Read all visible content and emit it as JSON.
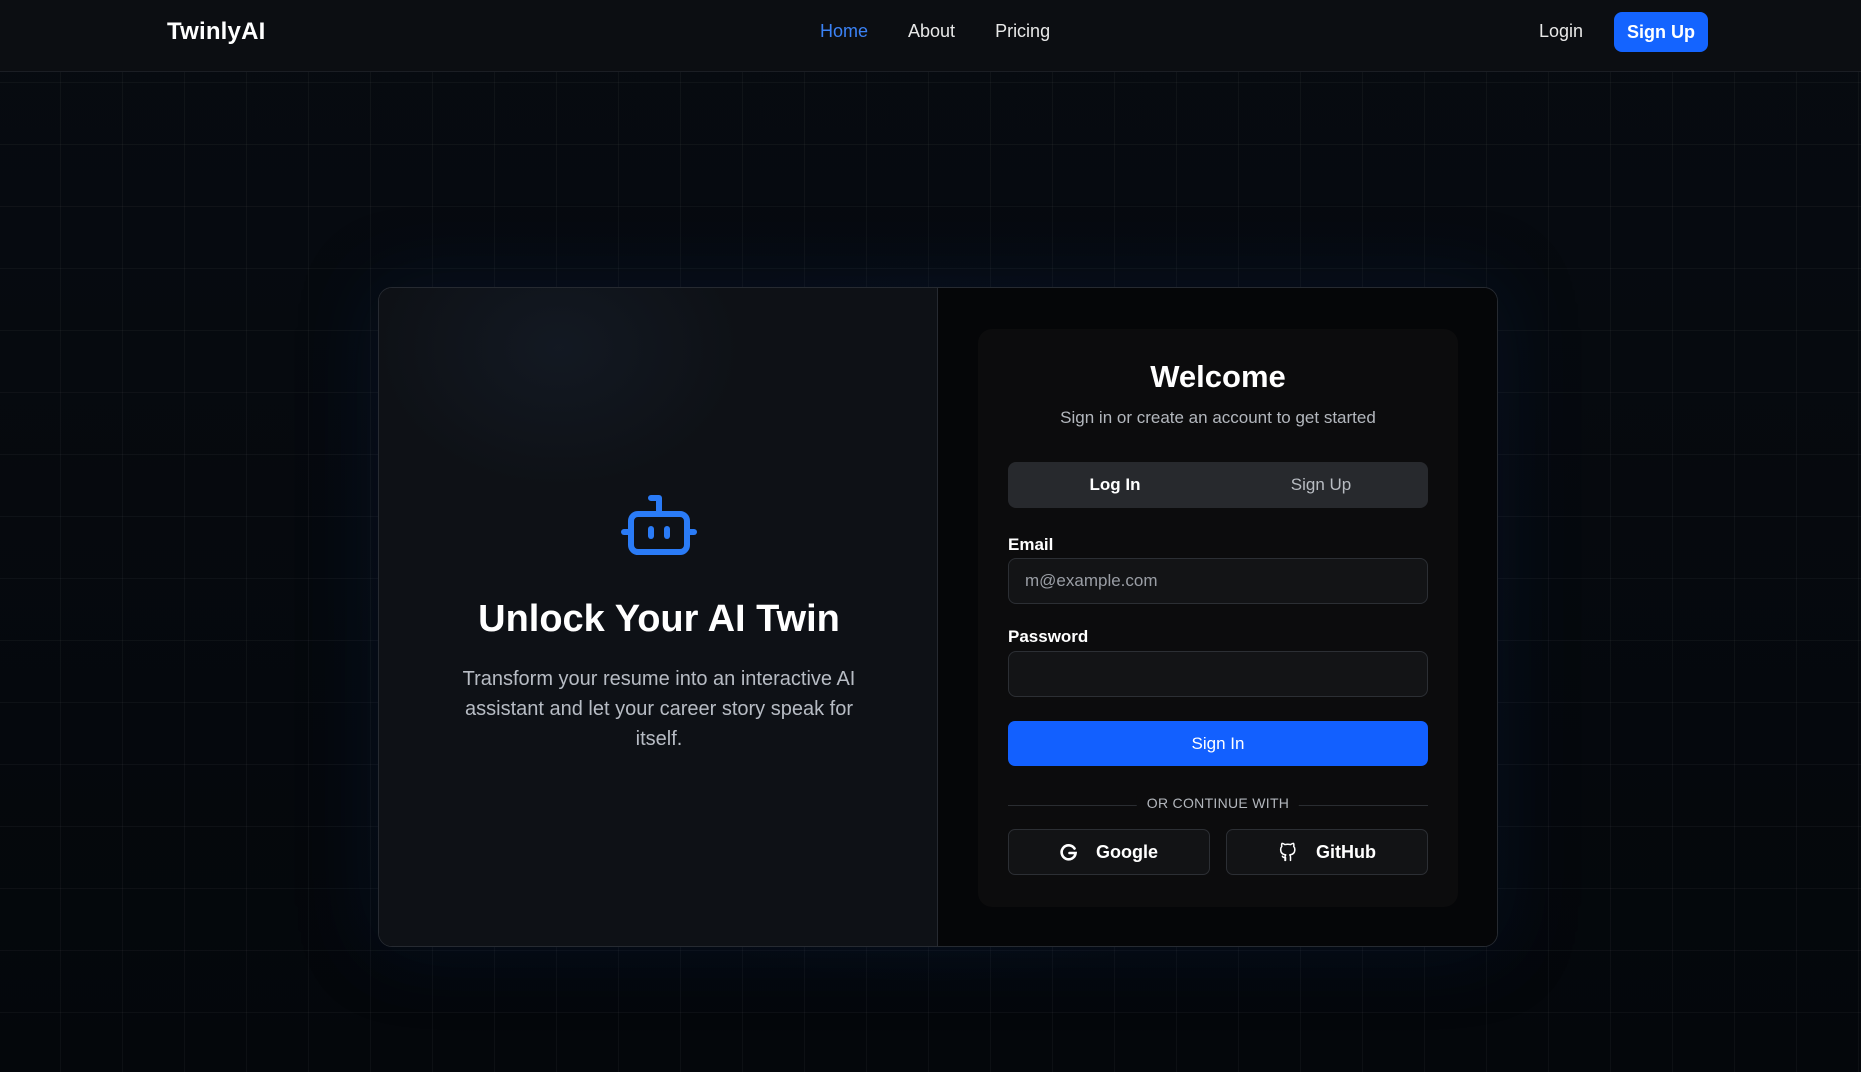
{
  "nav": {
    "brand": "TwinlyAI",
    "links": [
      {
        "label": "Home",
        "active": true
      },
      {
        "label": "About",
        "active": false
      },
      {
        "label": "Pricing",
        "active": false
      }
    ],
    "login_label": "Login",
    "signup_label": "Sign Up"
  },
  "hero": {
    "icon": "robot-icon",
    "title": "Unlock Your AI Twin",
    "description": "Transform your resume into an interactive AI assistant and let your career story speak for itself."
  },
  "auth": {
    "title": "Welcome",
    "subtitle": "Sign in or create an account to get started",
    "tabs": [
      {
        "label": "Log In",
        "active": true
      },
      {
        "label": "Sign Up",
        "active": false
      }
    ],
    "email_label": "Email",
    "email_placeholder": "m@example.com",
    "email_value": "",
    "password_label": "Password",
    "password_value": "",
    "submit_label": "Sign In",
    "divider_text": "OR CONTINUE WITH",
    "social": [
      {
        "label": "Google",
        "icon": "google-icon"
      },
      {
        "label": "GitHub",
        "icon": "github-icon"
      }
    ]
  },
  "colors": {
    "accent": "#1464ff",
    "active_link": "#3b82f6",
    "background": "#05080d"
  }
}
